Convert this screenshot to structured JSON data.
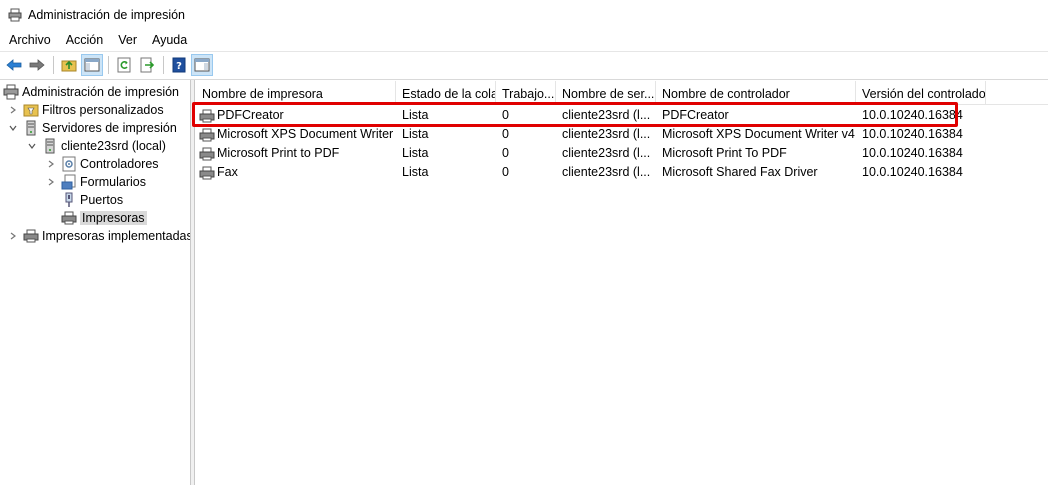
{
  "window": {
    "title": "Administración de impresión"
  },
  "menu": [
    {
      "label": "Archivo"
    },
    {
      "label": "Acción"
    },
    {
      "label": "Ver"
    },
    {
      "label": "Ayuda"
    }
  ],
  "tree": {
    "root": {
      "label": "Administración de impresión"
    },
    "filters": {
      "label": "Filtros personalizados"
    },
    "servers": {
      "label": "Servidores de impresión"
    },
    "server": {
      "label": "cliente23srd (local)"
    },
    "drivers": {
      "label": "Controladores"
    },
    "forms": {
      "label": "Formularios"
    },
    "ports": {
      "label": "Puertos"
    },
    "printers": {
      "label": "Impresoras"
    },
    "deployed": {
      "label": "Impresoras implementadas"
    }
  },
  "list": {
    "columns": [
      "Nombre de impresora",
      "Estado de la cola",
      "Trabajo...",
      "Nombre de ser...",
      "Nombre de controlador",
      "Versión del controlador"
    ],
    "rows": [
      {
        "name": "PDFCreator",
        "status": "Lista",
        "jobs": "0",
        "server": "cliente23srd (l...",
        "driver": "PDFCreator",
        "version": "10.0.10240.16384"
      },
      {
        "name": "Microsoft XPS Document Writer",
        "status": "Lista",
        "jobs": "0",
        "server": "cliente23srd (l...",
        "driver": "Microsoft XPS Document Writer v4",
        "version": "10.0.10240.16384"
      },
      {
        "name": "Microsoft Print to PDF",
        "status": "Lista",
        "jobs": "0",
        "server": "cliente23srd (l...",
        "driver": "Microsoft Print To PDF",
        "version": "10.0.10240.16384"
      },
      {
        "name": "Fax",
        "status": "Lista",
        "jobs": "0",
        "server": "cliente23srd (l...",
        "driver": "Microsoft Shared Fax Driver",
        "version": "10.0.10240.16384"
      }
    ]
  },
  "colors": {
    "highlight": "#e00000",
    "selection": "#d9d9d9",
    "toolbar_active": "#cce4f7"
  }
}
